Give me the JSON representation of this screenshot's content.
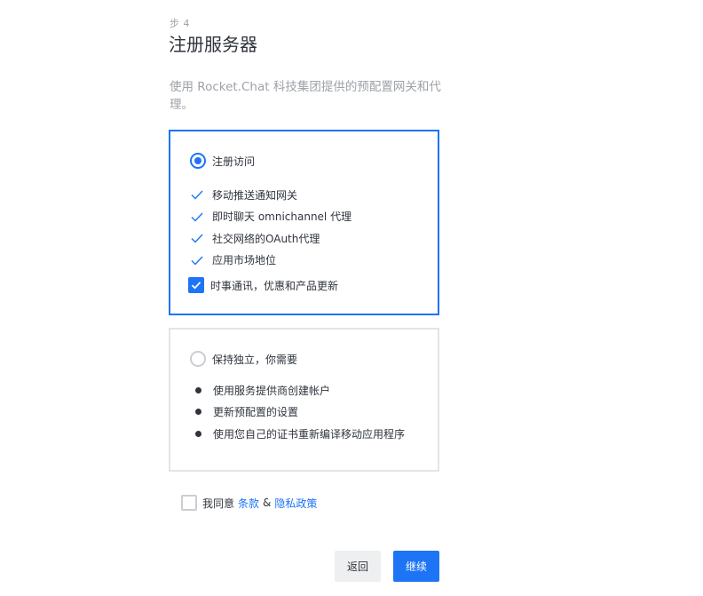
{
  "step": {
    "label": "步 4"
  },
  "page": {
    "title": "注册服务器",
    "description": "使用 Rocket.Chat 科技集团提供的预配置网关和代理。"
  },
  "registered_option": {
    "label": "注册访问",
    "selected": true,
    "features": [
      "移动推送通知网关",
      "即时聊天 omnichannel 代理",
      "社交网络的OAuth代理",
      "应用市场地位"
    ],
    "newsletter": {
      "label": "时事通讯，优惠和产品更新",
      "checked": true
    }
  },
  "standalone_option": {
    "label": "保持独立，你需要",
    "selected": false,
    "requirements": [
      "使用服务提供商创建帐户",
      "更新预配置的设置",
      "使用您自己的证书重新编译移动应用程序"
    ]
  },
  "agreement": {
    "prefix": "我同意",
    "terms_link": "条款",
    "ampersand": "&",
    "privacy_link": "隐私政策",
    "checked": false
  },
  "buttons": {
    "back": "返回",
    "continue": "继续"
  },
  "colors": {
    "accent": "#1d74f5",
    "muted_text": "#9ea2a8",
    "border": "#e1e5e8"
  }
}
